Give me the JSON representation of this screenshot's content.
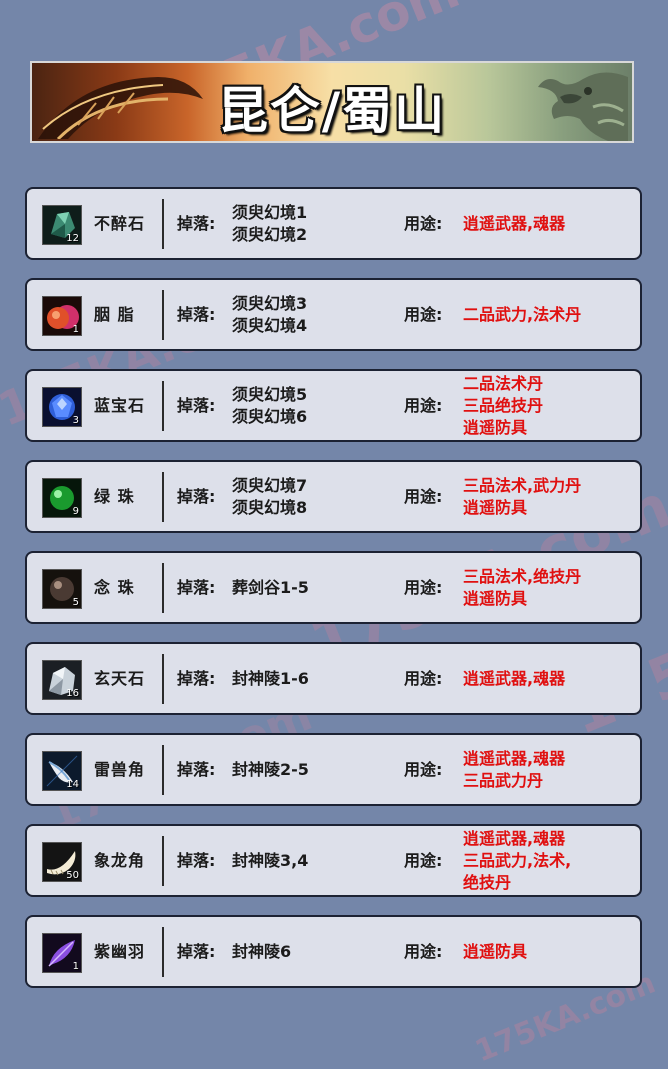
{
  "watermark": "175KA.com",
  "header": {
    "title": "昆仑/蜀山"
  },
  "labels": {
    "drop": "掉落:",
    "use": "用途:"
  },
  "colors": {
    "background": "#7486a9",
    "row_bg": "#dde0ea",
    "use_text": "#e01010"
  },
  "items": [
    {
      "icon": "green-ore-icon",
      "qty": "12",
      "name": "不醉石",
      "drop": [
        "须臾幻境1",
        "须臾幻境2"
      ],
      "use": [
        "逍遥武器,魂器"
      ]
    },
    {
      "icon": "rouge-icon",
      "qty": "1",
      "name": "胭 脂",
      "drop": [
        "须臾幻境3",
        "须臾幻境4"
      ],
      "use": [
        "二品武力,法术丹"
      ]
    },
    {
      "icon": "sapphire-icon",
      "qty": "3",
      "name": "蓝宝石",
      "drop": [
        "须臾幻境5",
        "须臾幻境6"
      ],
      "use": [
        "二品法术丹",
        "三品绝技丹",
        "逍遥防具"
      ]
    },
    {
      "icon": "green-pearl-icon",
      "qty": "9",
      "name": "绿 珠",
      "drop": [
        "须臾幻境7",
        "须臾幻境8"
      ],
      "use": [
        "三品法术,武力丹",
        "逍遥防具"
      ]
    },
    {
      "icon": "prayer-bead-icon",
      "qty": "5",
      "name": "念 珠",
      "drop": [
        "葬剑谷1-5"
      ],
      "use": [
        "三品法术,绝技丹",
        "逍遥防具"
      ]
    },
    {
      "icon": "white-stone-icon",
      "qty": "16",
      "name": "玄天石",
      "drop": [
        "封神陵1-6"
      ],
      "use": [
        "逍遥武器,魂器"
      ]
    },
    {
      "icon": "beast-horn-icon",
      "qty": "14",
      "name": "雷兽角",
      "drop": [
        "封神陵2-5"
      ],
      "use": [
        "逍遥武器,魂器",
        "三品武力丹"
      ]
    },
    {
      "icon": "ivory-horn-icon",
      "qty": "50",
      "name": "象龙角",
      "drop": [
        "封神陵3,4"
      ],
      "use": [
        "逍遥武器,魂器",
        "三品武力,法术,",
        "绝技丹"
      ]
    },
    {
      "icon": "purple-feather-icon",
      "qty": "1",
      "name": "紫幽羽",
      "drop": [
        "封神陵6"
      ],
      "use": [
        "逍遥防具"
      ]
    }
  ]
}
